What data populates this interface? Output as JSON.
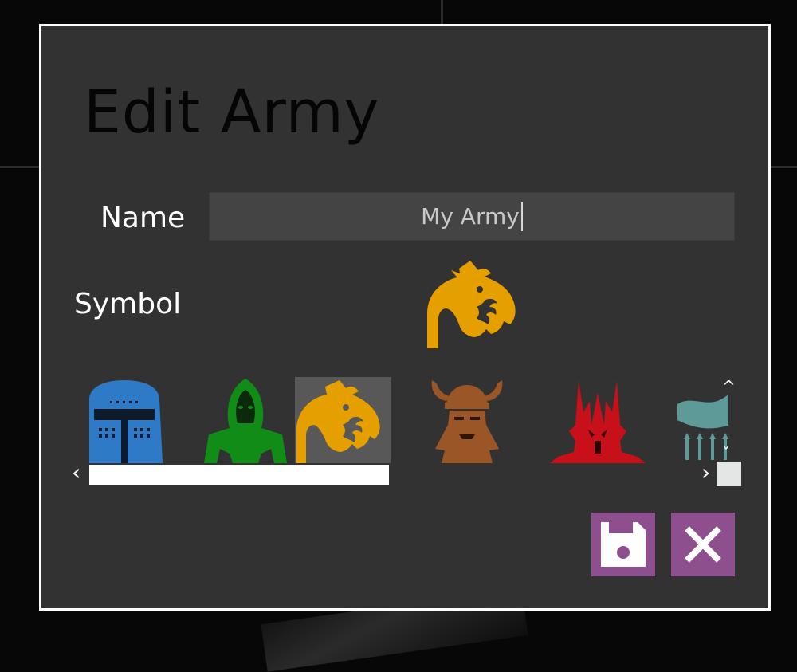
{
  "dialog": {
    "title": "Edit Army",
    "name_label": "Name",
    "name_value": "My Army",
    "symbol_label": "Symbol"
  },
  "symbols": [
    {
      "name": "knight-helmet",
      "color": "#2e7ac6",
      "selected": false
    },
    {
      "name": "hooded-figure",
      "color": "#118d17",
      "selected": false
    },
    {
      "name": "dragon",
      "color": "#e5a000",
      "selected": true
    },
    {
      "name": "viking-dwarf",
      "color": "#9b5628",
      "selected": false
    },
    {
      "name": "dark-lord",
      "color": "#c8101a",
      "selected": false
    },
    {
      "name": "banner-spears",
      "color": "#5e9b98",
      "selected": false
    }
  ],
  "colors": {
    "accent_button": "#8e4f8e",
    "dialog_bg": "#323232",
    "input_bg": "#444444"
  },
  "scroll": {
    "left_arrow": "‹",
    "right_arrow": "›",
    "up_arrow": "^",
    "down_arrow": "ˇ"
  },
  "buttons": {
    "save_icon": "floppy-disk-icon",
    "cancel_icon": "close-icon"
  }
}
